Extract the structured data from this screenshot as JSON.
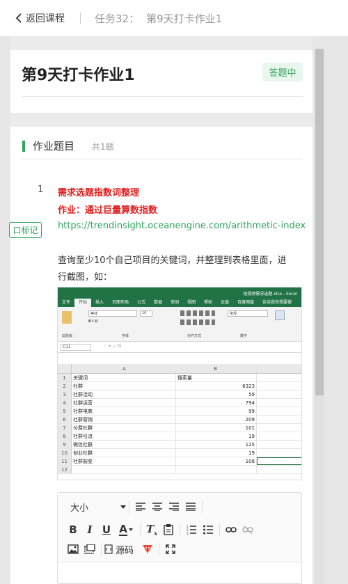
{
  "nav": {
    "back_label": "返回课程",
    "task_label": "任务32：",
    "task_title": "第9天打卡作业1"
  },
  "homework": {
    "title": "第9天打卡作业1",
    "status": "答题中"
  },
  "section": {
    "title": "作业题目",
    "count": "共1题"
  },
  "question": {
    "number": "1",
    "mark_label": "口标记",
    "heading": "需求选题指数词整理",
    "task": "作业：通过巨量算数指数",
    "link": "https://trendinsight.oceanengine.com/arithmetic-index",
    "body_line1": "查询至少10个自己项目的关键词，并整理到表格里面，进",
    "body_line2": "行截图，如："
  },
  "excel": {
    "file_title": "短视频需求选题.xlsx - Excel",
    "tabs": [
      "文件",
      "开始",
      "插入",
      "页面布局",
      "公式",
      "数据",
      "审阅",
      "视图",
      "帮助",
      "云盘",
      "百度网盘",
      "告诉我你想要做"
    ],
    "ribbon_groups": [
      "剪贴板",
      "字体",
      "对齐方式",
      "数字"
    ],
    "font_name": "等线",
    "font_size": "10",
    "number_format": "常规",
    "cell_ref": "C11",
    "col_headers": [
      "A",
      "B"
    ],
    "rows": [
      {
        "n": "1",
        "a": "关键词",
        "b": "搜索量"
      },
      {
        "n": "2",
        "a": "社群",
        "b": "6323"
      },
      {
        "n": "3",
        "a": "社群活动",
        "b": "59"
      },
      {
        "n": "4",
        "a": "社群运营",
        "b": "794"
      },
      {
        "n": "5",
        "a": "社群电商",
        "b": "99"
      },
      {
        "n": "6",
        "a": "社群营销",
        "b": "209"
      },
      {
        "n": "7",
        "a": "付费社群",
        "b": "101"
      },
      {
        "n": "8",
        "a": "社群引流",
        "b": "19"
      },
      {
        "n": "9",
        "a": "微信社群",
        "b": "125"
      },
      {
        "n": "10",
        "a": "创业社群",
        "b": "19"
      },
      {
        "n": "11",
        "a": "社群裂变",
        "b": "108"
      },
      {
        "n": "12",
        "a": "",
        "b": ""
      }
    ]
  },
  "editor": {
    "size_label": "大小",
    "source_label": "源码"
  },
  "colors": {
    "accent_green": "#2fa45e",
    "excel_green": "#217346",
    "red_text": "#e02020"
  }
}
